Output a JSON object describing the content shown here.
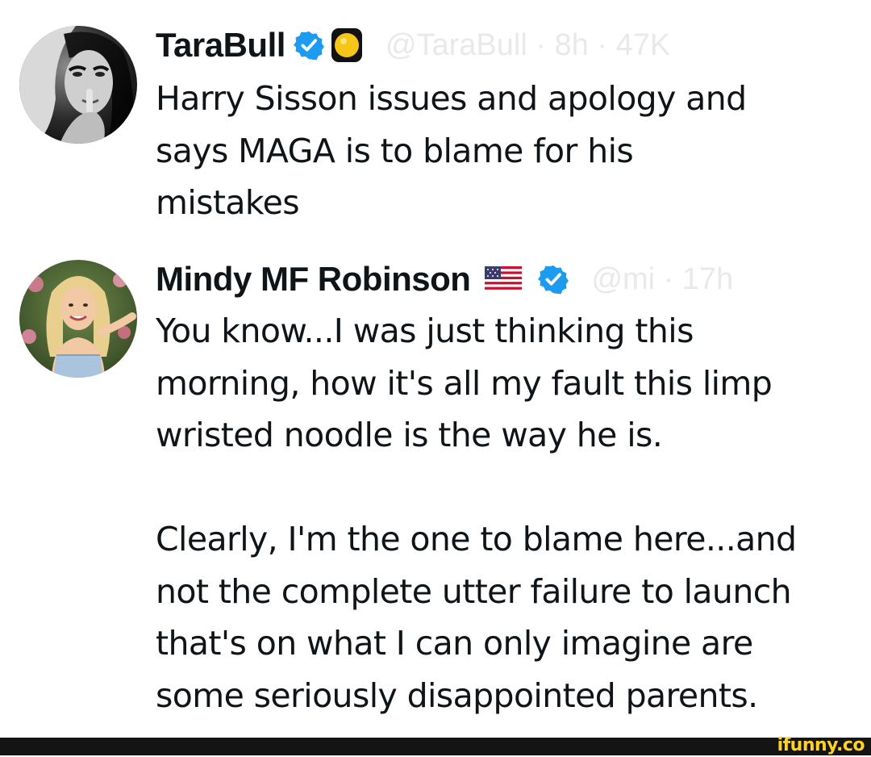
{
  "tweets": [
    {
      "display_name": "TaraBull",
      "verified": true,
      "badge_icon": "yellow-circle-emoji",
      "handle_faded": "@TaraBull · 8h · 47K",
      "text": "Harry Sisson issues and apology and\nsays MAGA is to blame for his\nmistakes",
      "avatar_icon": "bw-portrait-avatar"
    },
    {
      "display_name": "Mindy MF Robinson",
      "verified": true,
      "badge_icon": "us-flag-emoji",
      "handle_faded": "@mi · 17h",
      "text": "You know...I was just thinking this\nmorning, how it's all my fault this limp\nwristed noodle is the way he is.\n\nClearly, I'm the one to blame here...and\nnot the complete utter failure to launch\nthat's on what I can only imagine are\nsome seriously disappointed parents.",
      "avatar_icon": "blonde-woman-avatar"
    }
  ],
  "watermark": {
    "text": "ifunny.co"
  },
  "colors": {
    "text": "#0f1419",
    "verified_blue": "#1d9bf0",
    "watermark_yellow": "#ffd21e",
    "footer_bg": "#141414"
  }
}
